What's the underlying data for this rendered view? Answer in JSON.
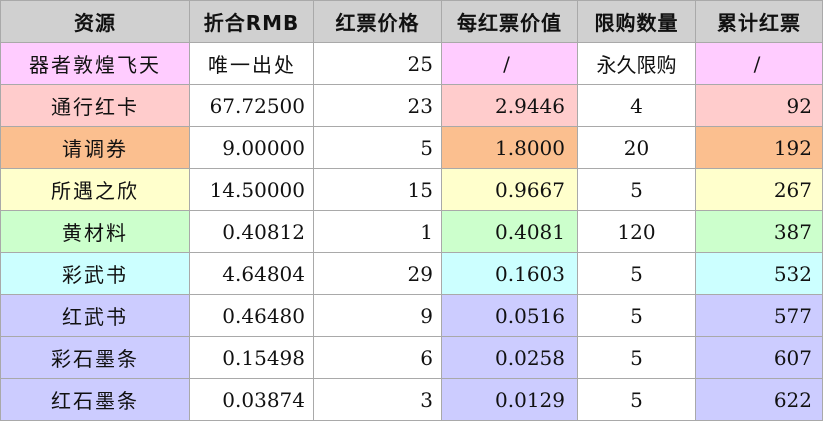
{
  "colors": {
    "header_bg": "#d0d0d0",
    "border": "#a9a9a9",
    "white": "#ffffff"
  },
  "headers": [
    "资源",
    "折合RMB",
    "红票价格",
    "每红票价值",
    "限购数量",
    "累计红票"
  ],
  "rows": [
    {
      "name": "器者敦煌飞天",
      "rmb": "唯一出处",
      "price": "25",
      "per": "/",
      "limit": "永久限购",
      "total": "/",
      "color": "#ffccff",
      "rmb_align": "left",
      "per_align": "center",
      "total_align": "center"
    },
    {
      "name": "通行红卡",
      "rmb": "67.72500",
      "price": "23",
      "per": "2.9446",
      "limit": "4",
      "total": "92",
      "color": "#ffcccc"
    },
    {
      "name": "请调券",
      "rmb": "9.00000",
      "price": "5",
      "per": "1.8000",
      "limit": "20",
      "total": "192",
      "color": "#fbbf8f"
    },
    {
      "name": "所遇之欣",
      "rmb": "14.50000",
      "price": "15",
      "per": "0.9667",
      "limit": "5",
      "total": "267",
      "color": "#ffffcc"
    },
    {
      "name": "黄材料",
      "rmb": "0.40812",
      "price": "1",
      "per": "0.4081",
      "limit": "120",
      "total": "387",
      "color": "#ccffcc"
    },
    {
      "name": "彩武书",
      "rmb": "4.64804",
      "price": "29",
      "per": "0.1603",
      "limit": "5",
      "total": "532",
      "color": "#ccffff"
    },
    {
      "name": "红武书",
      "rmb": "0.46480",
      "price": "9",
      "per": "0.0516",
      "limit": "5",
      "total": "577",
      "color": "#ccccff"
    },
    {
      "name": "彩石墨条",
      "rmb": "0.15498",
      "price": "6",
      "per": "0.0258",
      "limit": "5",
      "total": "607",
      "color": "#ccccff"
    },
    {
      "name": "红石墨条",
      "rmb": "0.03874",
      "price": "3",
      "per": "0.0129",
      "limit": "5",
      "total": "622",
      "color": "#ccccff"
    }
  ]
}
